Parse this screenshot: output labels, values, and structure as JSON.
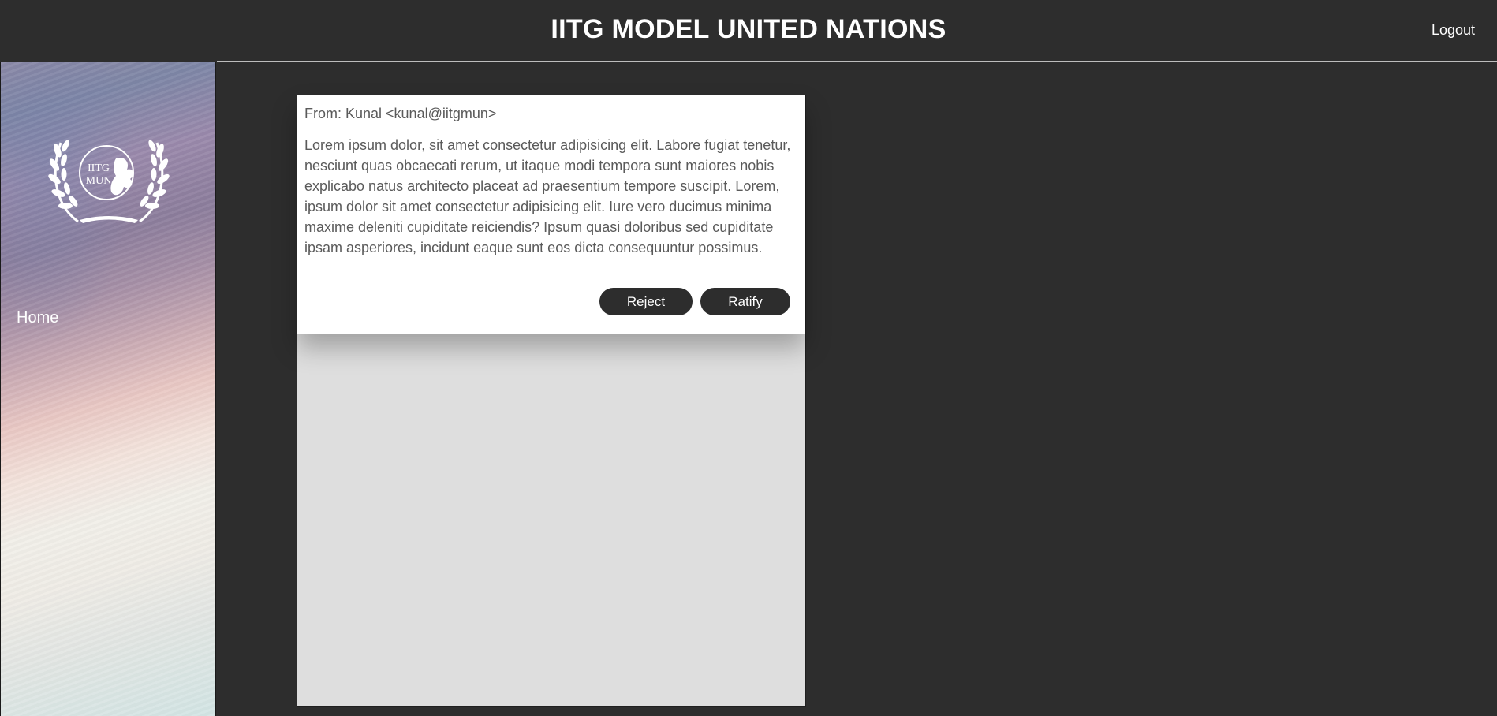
{
  "header": {
    "title": "IITG MODEL UNITED NATIONS",
    "logout_label": "Logout"
  },
  "sidebar": {
    "logo_text_line1": "IITG",
    "logo_text_line2": "MUN",
    "items": [
      {
        "label": "Home"
      }
    ]
  },
  "message": {
    "from": "From: Kunal <kunal@iitgmun>",
    "body": "Lorem ipsum dolor, sit amet consectetur adipisicing elit. Labore fugiat tenetur, nesciunt quas obcaecati rerum, ut itaque modi tempora sunt maiores nobis explicabo natus architecto placeat ad praesentium tempore suscipit. Lorem, ipsum dolor sit amet consectetur adipisicing elit. Iure vero ducimus minima maxime deleniti cupiditate reiciendis? Ipsum quasi doloribus sed cupiditate ipsam asperiores, incidunt eaque sunt eos dicta consequuntur possimus.",
    "reject_label": "Reject",
    "ratify_label": "Ratify"
  },
  "colors": {
    "background": "#2d2d2d",
    "button": "#2d2d2d",
    "card": "#ffffff",
    "panel": "#dedede",
    "text_muted": "#5a5a5a"
  },
  "icons": {
    "logo": "un-laurel-emblem-icon"
  }
}
